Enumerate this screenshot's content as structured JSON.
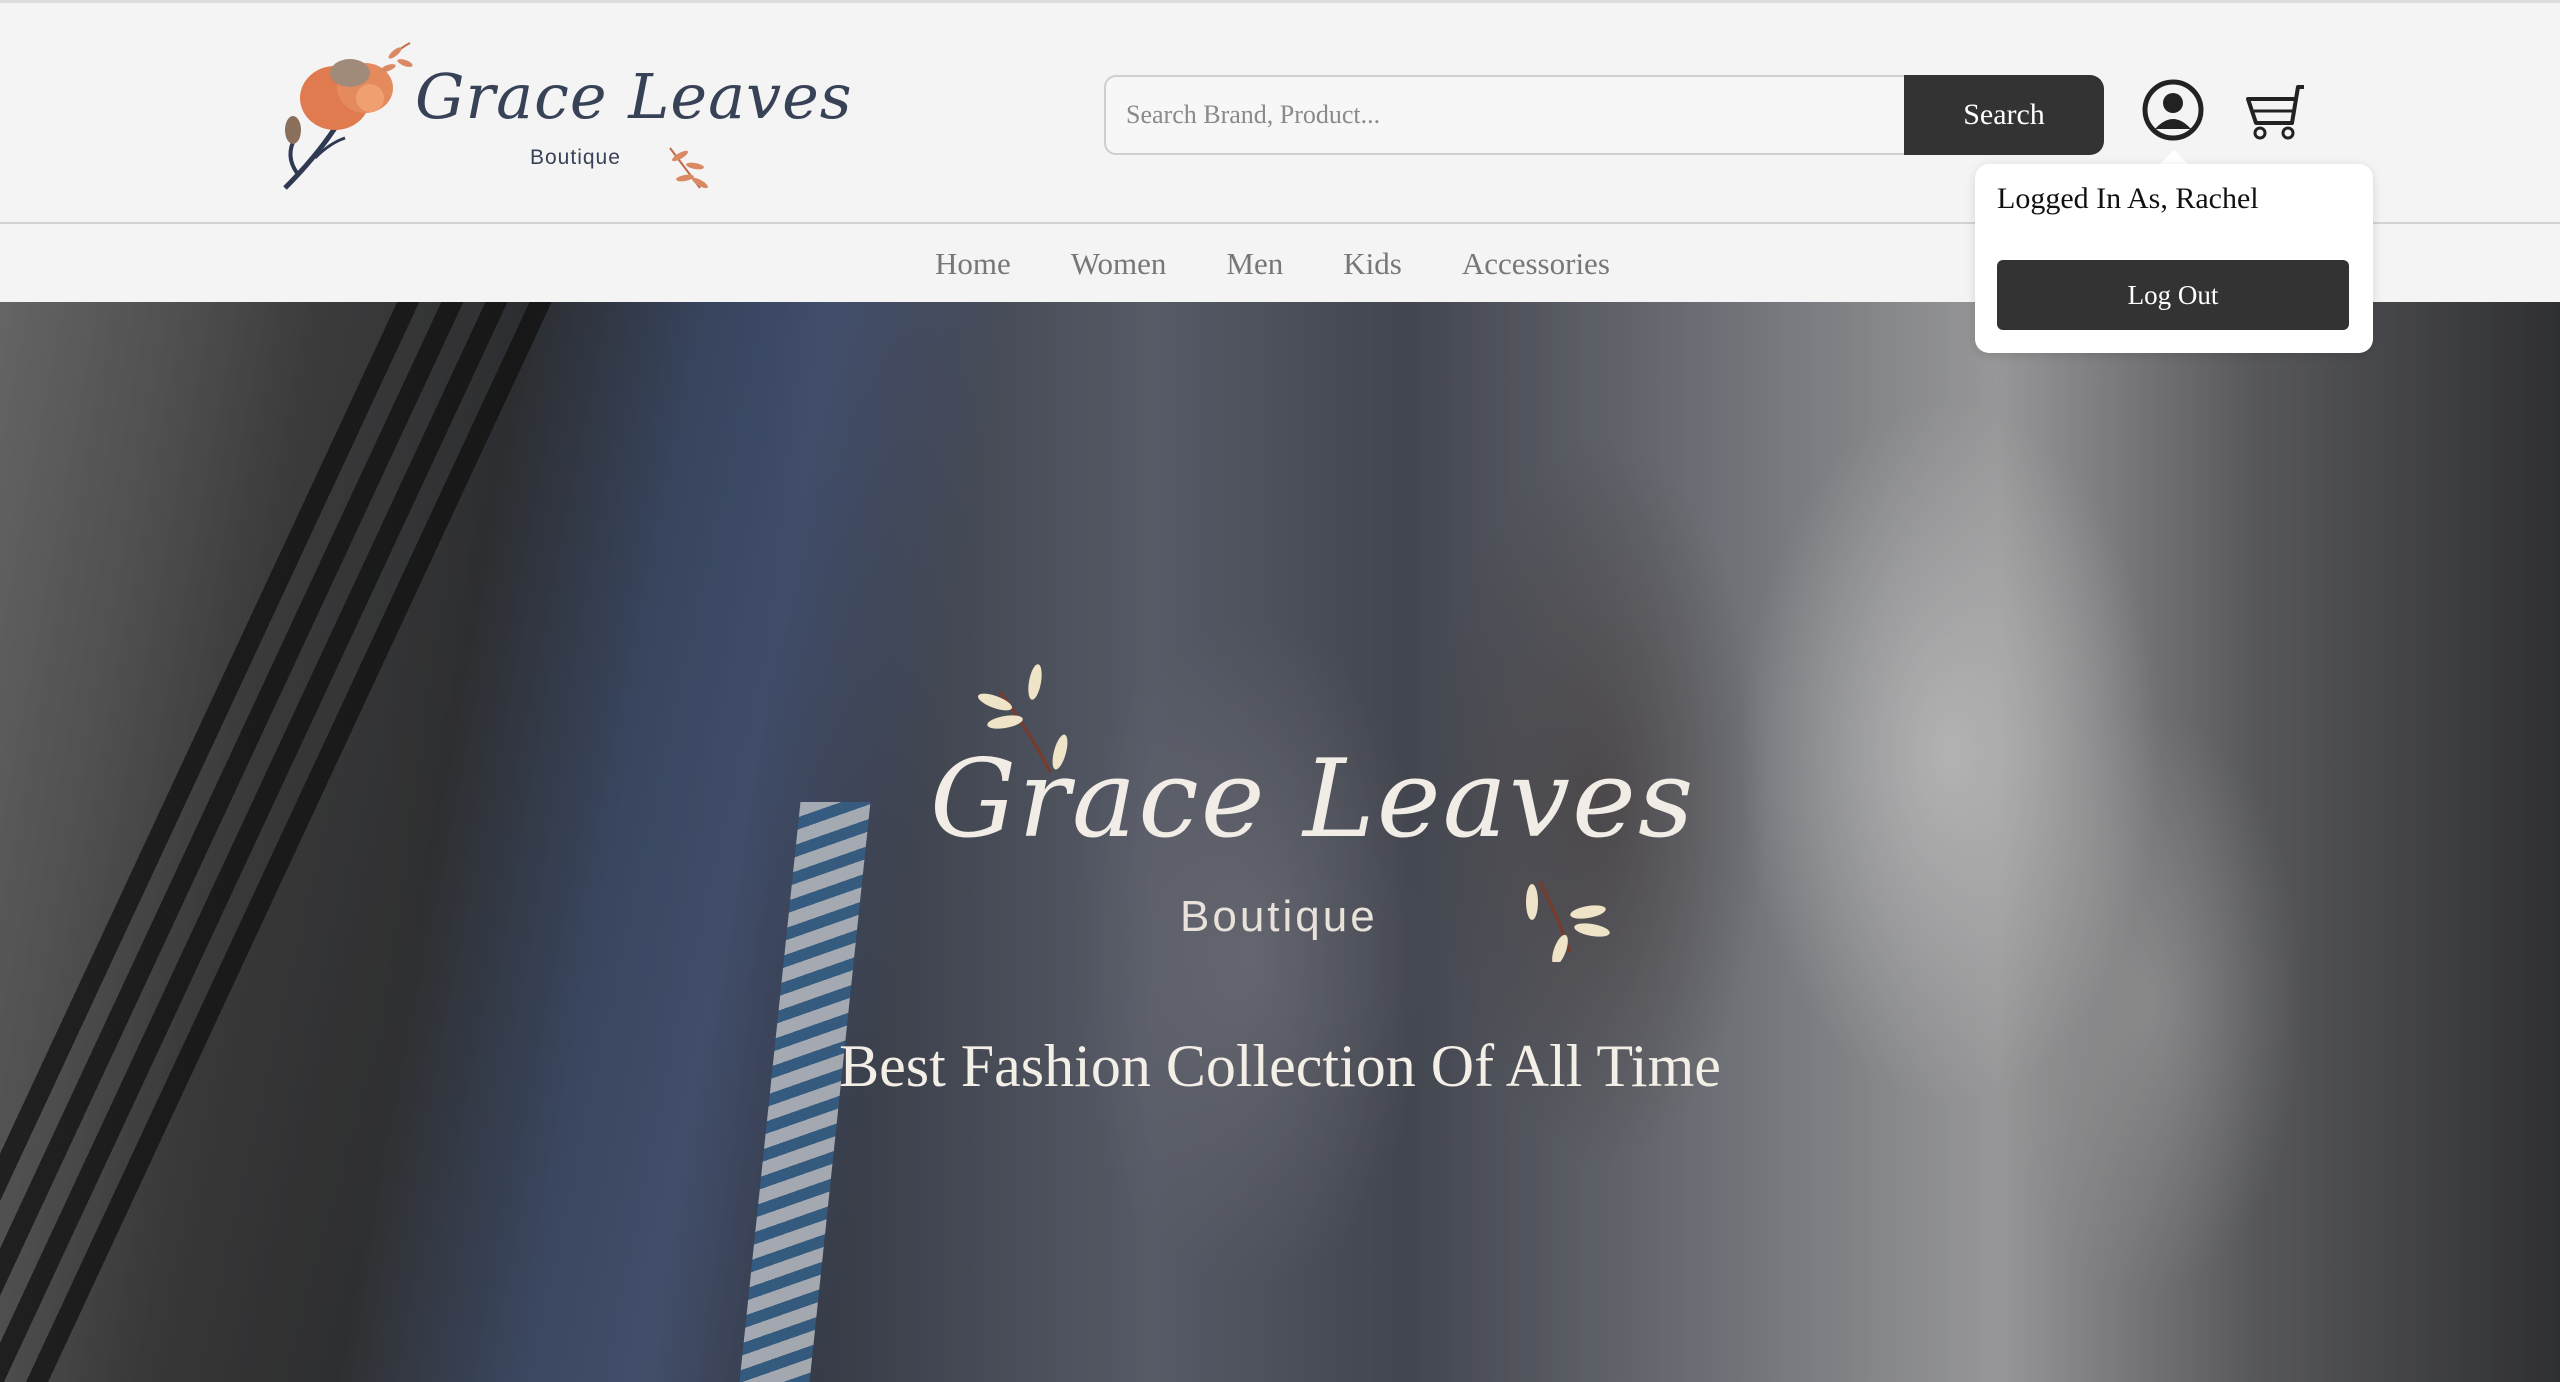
{
  "brand": {
    "name_script": "Grace Leaves",
    "name_sub": "Boutique"
  },
  "search": {
    "placeholder": "Search Brand, Product...",
    "button_label": "Search"
  },
  "icons": {
    "account": "user-circle-icon",
    "cart": "shopping-cart-icon"
  },
  "nav": {
    "items": [
      {
        "label": "Home"
      },
      {
        "label": "Women"
      },
      {
        "label": "Men"
      },
      {
        "label": "Kids"
      },
      {
        "label": "Accessories"
      }
    ]
  },
  "account_menu": {
    "user_text": "Logged In As, Rachel",
    "logout_label": "Log Out"
  },
  "hero": {
    "logo_script": "Grace Leaves",
    "logo_sub": "Boutique",
    "tagline": "Best Fashion Collection Of All Time"
  },
  "colors": {
    "primary_dark": "#333333",
    "logo_navy": "#384257",
    "logo_orange": "#e07a4f",
    "background": "#f4f4f4"
  }
}
